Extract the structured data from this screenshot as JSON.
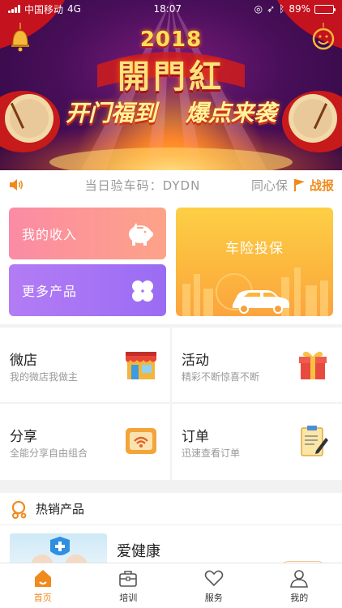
{
  "status_bar": {
    "carrier": "中国移动",
    "network": "4G",
    "time": "18:07",
    "battery": "89%",
    "battery_level": 0.89
  },
  "banner": {
    "year": "2018",
    "title": "開門紅",
    "slogan_left": "开门福到",
    "slogan_right": "爆点来袭"
  },
  "notice": {
    "text": "当日验车码：DYDN",
    "tail": "同心保",
    "flag_label": "战报"
  },
  "cards": {
    "income": "我的收入",
    "more_products": "更多产品",
    "car_insurance": "车险投保"
  },
  "grid": [
    {
      "title": "微店",
      "subtitle": "我的微店我做主",
      "icon": "shop-icon"
    },
    {
      "title": "活动",
      "subtitle": "精彩不断惊喜不断",
      "icon": "gift-icon"
    },
    {
      "title": "分享",
      "subtitle": "全能分享自由组合",
      "icon": "wifi-share-icon"
    },
    {
      "title": "订单",
      "subtitle": "迅速查看订单",
      "icon": "clipboard-icon"
    }
  ],
  "hot": {
    "heading": "热销产品",
    "product_name": "爱健康"
  },
  "tabbar": [
    {
      "label": "首页",
      "icon": "home-icon",
      "active": true
    },
    {
      "label": "培训",
      "icon": "briefcase-icon",
      "active": false
    },
    {
      "label": "服务",
      "icon": "heart-icon",
      "active": false
    },
    {
      "label": "我的",
      "icon": "person-icon",
      "active": false
    }
  ],
  "colors": {
    "accent": "#f08a1c",
    "income_card": "#fb8ba4",
    "more_card": "#b37cf5",
    "insure_card": "#fcb83e"
  }
}
